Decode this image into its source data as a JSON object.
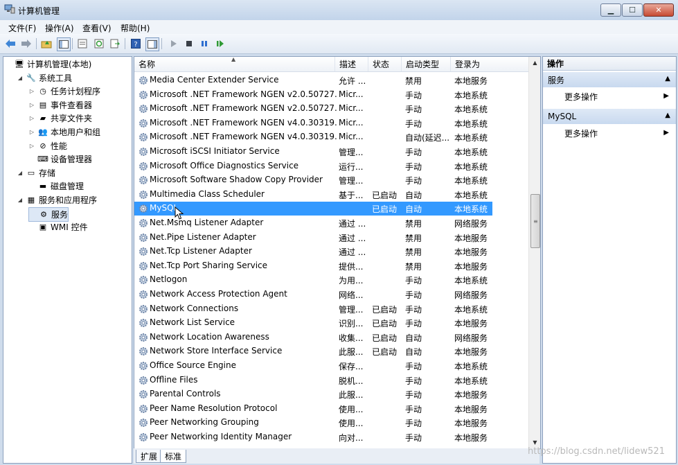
{
  "window": {
    "title": "计算机管理"
  },
  "menu": [
    "文件(F)",
    "操作(A)",
    "查看(V)",
    "帮助(H)"
  ],
  "tree": [
    {
      "label": "计算机管理(本地)",
      "exp": "",
      "icon": "computer-icon",
      "indent": 0,
      "sel": false
    },
    {
      "label": "系统工具",
      "exp": "◢",
      "icon": "tools-icon",
      "indent": 1,
      "sel": false
    },
    {
      "label": "任务计划程序",
      "exp": "▷",
      "icon": "clock-icon",
      "indent": 2,
      "sel": false
    },
    {
      "label": "事件查看器",
      "exp": "▷",
      "icon": "event-viewer-icon",
      "indent": 2,
      "sel": false
    },
    {
      "label": "共享文件夹",
      "exp": "▷",
      "icon": "shared-folder-icon",
      "indent": 2,
      "sel": false
    },
    {
      "label": "本地用户和组",
      "exp": "▷",
      "icon": "users-icon",
      "indent": 2,
      "sel": false
    },
    {
      "label": "性能",
      "exp": "▷",
      "icon": "performance-icon",
      "indent": 2,
      "sel": false
    },
    {
      "label": "设备管理器",
      "exp": "",
      "icon": "device-manager-icon",
      "indent": 2,
      "sel": false
    },
    {
      "label": "存储",
      "exp": "◢",
      "icon": "storage-icon",
      "indent": 1,
      "sel": false
    },
    {
      "label": "磁盘管理",
      "exp": "",
      "icon": "disk-icon",
      "indent": 2,
      "sel": false
    },
    {
      "label": "服务和应用程序",
      "exp": "◢",
      "icon": "apps-icon",
      "indent": 1,
      "sel": false
    },
    {
      "label": "服务",
      "exp": "",
      "icon": "services-gear-icon",
      "indent": 2,
      "sel": true
    },
    {
      "label": "WMI 控件",
      "exp": "",
      "icon": "wmi-icon",
      "indent": 2,
      "sel": false
    }
  ],
  "columns": [
    "名称",
    "描述",
    "状态",
    "启动类型",
    "登录为"
  ],
  "rows": [
    [
      "Media Center Extender Service",
      "允许 ...",
      "",
      "禁用",
      "本地服务"
    ],
    [
      "Microsoft .NET Framework NGEN v2.0.50727...",
      "Micr...",
      "",
      "手动",
      "本地系统"
    ],
    [
      "Microsoft .NET Framework NGEN v2.0.50727...",
      "Micr...",
      "",
      "手动",
      "本地系统"
    ],
    [
      "Microsoft .NET Framework NGEN v4.0.30319...",
      "Micr...",
      "",
      "手动",
      "本地系统"
    ],
    [
      "Microsoft .NET Framework NGEN v4.0.30319...",
      "Micr...",
      "",
      "自动(延迟...",
      "本地系统"
    ],
    [
      "Microsoft iSCSI Initiator Service",
      "管理...",
      "",
      "手动",
      "本地系统"
    ],
    [
      "Microsoft Office Diagnostics Service",
      "运行...",
      "",
      "手动",
      "本地系统"
    ],
    [
      "Microsoft Software Shadow Copy Provider",
      "管理...",
      "",
      "手动",
      "本地系统"
    ],
    [
      "Multimedia Class Scheduler",
      "基于...",
      "已启动",
      "自动",
      "本地系统"
    ],
    [
      "MySQL",
      "",
      "已启动",
      "自动",
      "本地系统"
    ],
    [
      "Net.Msmq Listener Adapter",
      "通过 ...",
      "",
      "禁用",
      "网络服务"
    ],
    [
      "Net.Pipe Listener Adapter",
      "通过 ...",
      "",
      "禁用",
      "本地服务"
    ],
    [
      "Net.Tcp Listener Adapter",
      "通过 ...",
      "",
      "禁用",
      "本地服务"
    ],
    [
      "Net.Tcp Port Sharing Service",
      "提供...",
      "",
      "禁用",
      "本地服务"
    ],
    [
      "Netlogon",
      "为用...",
      "",
      "手动",
      "本地系统"
    ],
    [
      "Network Access Protection Agent",
      "网络...",
      "",
      "手动",
      "网络服务"
    ],
    [
      "Network Connections",
      "管理...",
      "已启动",
      "手动",
      "本地系统"
    ],
    [
      "Network List Service",
      "识别...",
      "已启动",
      "手动",
      "本地服务"
    ],
    [
      "Network Location Awareness",
      "收集...",
      "已启动",
      "自动",
      "网络服务"
    ],
    [
      "Network Store Interface Service",
      "此服...",
      "已启动",
      "自动",
      "本地服务"
    ],
    [
      "Office Source Engine",
      "保存...",
      "",
      "手动",
      "本地系统"
    ],
    [
      "Offline Files",
      "脱机...",
      "",
      "手动",
      "本地系统"
    ],
    [
      "Parental Controls",
      "此服...",
      "",
      "手动",
      "本地服务"
    ],
    [
      "Peer Name Resolution Protocol",
      "使用...",
      "",
      "手动",
      "本地服务"
    ],
    [
      "Peer Networking Grouping",
      "使用...",
      "",
      "手动",
      "本地服务"
    ],
    [
      "Peer Networking Identity Manager",
      "向对...",
      "",
      "手动",
      "本地服务"
    ]
  ],
  "selected_row": "MySQL",
  "tabs": [
    "扩展",
    "标准"
  ],
  "actions": {
    "title": "操作",
    "sections": [
      {
        "title": "服务",
        "item": "更多操作"
      },
      {
        "title": "MySQL",
        "item": "更多操作"
      }
    ]
  },
  "watermark": "https://blog.csdn.net/lidew521"
}
